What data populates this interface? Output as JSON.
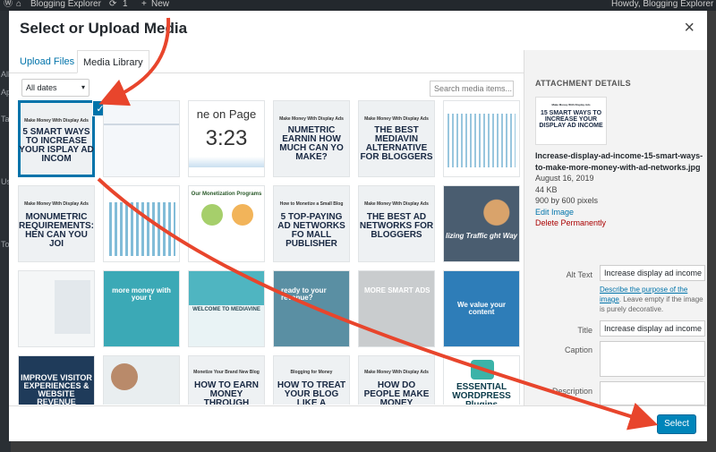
{
  "adminbar": {
    "site_name": "Blogging Explorer",
    "updates": "1",
    "new_label": "New",
    "greeting": "Howdy, Blogging Explorer"
  },
  "wp_sidebar": {
    "items": [
      "All",
      "Ap",
      "Ta",
      "Us",
      "To"
    ]
  },
  "modal": {
    "title": "Select or Upload Media",
    "close_icon": "close-icon"
  },
  "tabs": [
    {
      "label": "Upload Files"
    },
    {
      "label": "Media Library"
    }
  ],
  "toolbar": {
    "date_filter": "All dates",
    "search_placeholder": "Search media items..."
  },
  "grid": {
    "items": [
      {
        "sub": "Make Money With Display Ads",
        "main": "5 SMART WAYS TO INCREASE YOUR ISPLAY AD INCOM"
      },
      {
        "main": ""
      },
      {
        "top": "ne on Page",
        "big": "3:23"
      },
      {
        "sub": "Make Money With Display Ads",
        "main": "NUMETRIC EARNIN HOW MUCH CAN YO MAKE?"
      },
      {
        "sub": "Make Money With Display Ads",
        "main": "THE BEST MEDIAVIN ALTERNATIVE FOR BLOGGERS"
      },
      {
        "main": ""
      },
      {
        "sub": "Make Money With Display Ads",
        "main": "MONUMETRIC REQUIREMENTS: HEN CAN YOU JOI"
      },
      {
        "main": ""
      },
      {
        "sub": "Our Monetization Programs",
        "main": ""
      },
      {
        "sub": "How to Monetize a Small Blog",
        "main": "5 TOP-PAYING AD NETWORKS FO MALL PUBLISHER"
      },
      {
        "sub": "Make Money With Display Ads",
        "main": "THE BEST AD NETWORKS FOR BLOGGERS"
      },
      {
        "main": "lizing Traffic ght Way"
      },
      {
        "main": ""
      },
      {
        "main": "more money with your t"
      },
      {
        "main": "WELCOME TO MEDIAVINE"
      },
      {
        "main": "ready to your revenue?"
      },
      {
        "main": "MORE SMART ADS"
      },
      {
        "main": "We value your content"
      },
      {
        "main": "IMPROVE VISITOR EXPERIENCES & WEBSITE REVENUE"
      },
      {
        "main": ""
      },
      {
        "sub": "Monetize Your Brand New Blog",
        "main": "HOW TO EARN MONEY THROUGH BLOGGING?"
      },
      {
        "sub": "Blogging for Money",
        "main": "HOW TO TREAT YOUR BLOG LIKE A BUSINESS"
      },
      {
        "sub": "Make Money With Display Ads",
        "main": "HOW DO PEOPLE MAKE MONEY BLOGGING?"
      },
      {
        "main": "ESSENTIAL WORDPRESS Plugins"
      }
    ]
  },
  "details": {
    "heading": "ATTACHMENT DETAILS",
    "thumb_sub": "Make Money With Display Ads",
    "thumb_main": "15 SMART WAYS TO INCREASE YOUR DISPLAY AD INCOME",
    "filename": "Increase-display-ad-income-15-smart-ways-to-make-more-money-with-ad-networks.jpg",
    "date": "August 16, 2019",
    "size": "44 KB",
    "dimensions": "900 by 600 pixels",
    "edit_link": "Edit Image",
    "delete_link": "Delete Permanently",
    "alt_label": "Alt Text",
    "alt_value": "Increase display ad income",
    "alt_help_link": "Describe the purpose of the image",
    "alt_help_rest": ". Leave empty if the image is purely decorative.",
    "title_label": "Title",
    "title_value": "Increase display ad income",
    "caption_label": "Caption",
    "description_label": "Description"
  },
  "footer": {
    "select_label": "Select"
  },
  "colors": {
    "accent": "#0073aa",
    "button": "#0085ba",
    "arrow": "#e8452c",
    "delete": "#aa0000"
  }
}
